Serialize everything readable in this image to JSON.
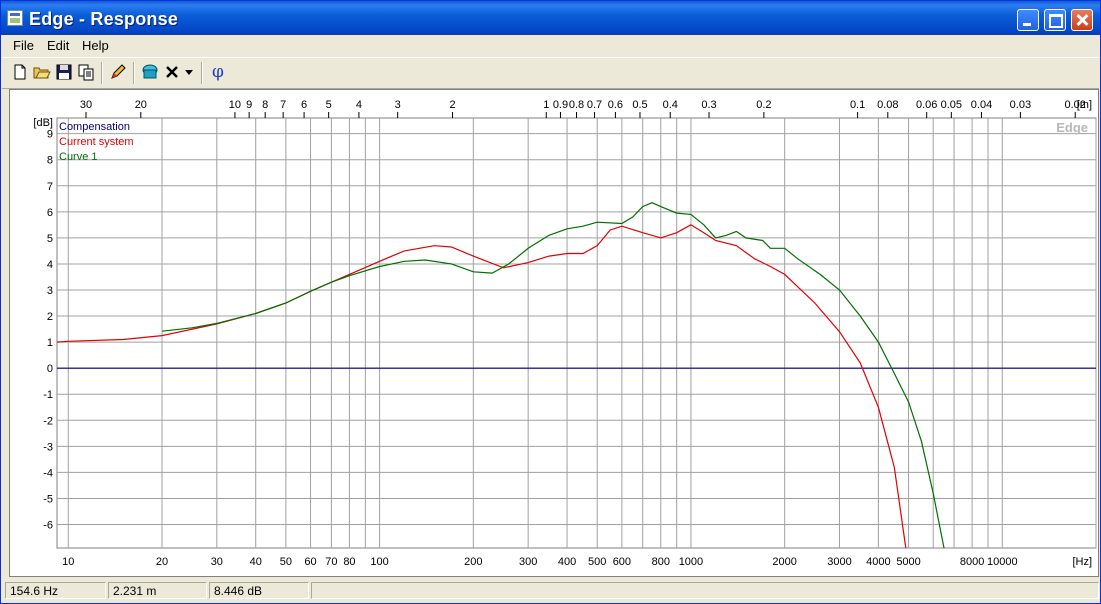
{
  "window": {
    "title": "Edge - Response"
  },
  "menu": [
    "File",
    "Edit",
    "Help"
  ],
  "toolbar": {
    "icons": [
      "new-file-icon",
      "open-folder-icon",
      "save-icon",
      "copy-icon",
      "pencil-icon",
      "speaker-icon",
      "delete-icon",
      "dropdown-arrow-icon",
      "phase-icon"
    ],
    "phase_label": "φ"
  },
  "status": {
    "frequency": "154.6 Hz",
    "distance": "2.231 m",
    "level": "8.446 dB"
  },
  "colors": {
    "compensation": "#000080",
    "current_system": "#e00000",
    "curve1": "#007000",
    "grid": "#a0a0a0",
    "title_bar": "#0a5fd8"
  },
  "chart_data": {
    "type": "line",
    "watermark": "Edge",
    "x_scale": "log",
    "x_range": [
      9.2,
      20000
    ],
    "y_range": [
      -6.9,
      9.6
    ],
    "ylabel": "[dB]",
    "xlabel": "[Hz]",
    "top_axis_label": "[m]",
    "y_ticks": [
      "9",
      "8",
      "7",
      "6",
      "5",
      "4",
      "3",
      "2",
      "1",
      "0",
      "-1",
      "-2",
      "-3",
      "-4",
      "-5",
      "-6"
    ],
    "x_ticks": [
      {
        "v": 10,
        "label": "10"
      },
      {
        "v": 20,
        "label": "20"
      },
      {
        "v": 30,
        "label": "30"
      },
      {
        "v": 40,
        "label": "40"
      },
      {
        "v": 50,
        "label": "50"
      },
      {
        "v": 60,
        "label": "60"
      },
      {
        "v": 70,
        "label": "70"
      },
      {
        "v": 80,
        "label": "80"
      },
      {
        "v": 100,
        "label": "100"
      },
      {
        "v": 200,
        "label": "200"
      },
      {
        "v": 300,
        "label": "300"
      },
      {
        "v": 400,
        "label": "400"
      },
      {
        "v": 500,
        "label": "500"
      },
      {
        "v": 600,
        "label": "600"
      },
      {
        "v": 800,
        "label": "800"
      },
      {
        "v": 1000,
        "label": "1000"
      },
      {
        "v": 2000,
        "label": "2000"
      },
      {
        "v": 3000,
        "label": "3000"
      },
      {
        "v": 4000,
        "label": "4000"
      },
      {
        "v": 5000,
        "label": "5000"
      },
      {
        "v": 8000,
        "label": "8000"
      },
      {
        "v": 10000,
        "label": "10000"
      }
    ],
    "x_grid": [
      10,
      20,
      30,
      40,
      50,
      60,
      70,
      80,
      90,
      100,
      200,
      300,
      400,
      500,
      600,
      700,
      800,
      900,
      1000,
      2000,
      3000,
      4000,
      5000,
      6000,
      7000,
      8000,
      9000,
      10000,
      20000
    ],
    "top_ticks": [
      {
        "v": 11.4,
        "label": "30"
      },
      {
        "v": 17.1,
        "label": "20"
      },
      {
        "v": 34.3,
        "label": "10"
      },
      {
        "v": 38.1,
        "label": "9"
      },
      {
        "v": 42.9,
        "label": "8"
      },
      {
        "v": 49.0,
        "label": "7"
      },
      {
        "v": 57.2,
        "label": "6"
      },
      {
        "v": 68.6,
        "label": "5"
      },
      {
        "v": 85.8,
        "label": "4"
      },
      {
        "v": 114.3,
        "label": "3"
      },
      {
        "v": 171.5,
        "label": "2"
      },
      {
        "v": 343,
        "label": "1"
      },
      {
        "v": 381,
        "label": "0.9"
      },
      {
        "v": 429,
        "label": "0.8"
      },
      {
        "v": 490,
        "label": "0.7"
      },
      {
        "v": 572,
        "label": "0.6"
      },
      {
        "v": 686,
        "label": "0.5"
      },
      {
        "v": 858,
        "label": "0.4"
      },
      {
        "v": 1143,
        "label": "0.3"
      },
      {
        "v": 1715,
        "label": "0.2"
      },
      {
        "v": 3430,
        "label": "0.1"
      },
      {
        "v": 4288,
        "label": "0.08"
      },
      {
        "v": 5717,
        "label": "0.06"
      },
      {
        "v": 6860,
        "label": "0.05"
      },
      {
        "v": 8575,
        "label": "0.04"
      },
      {
        "v": 11433,
        "label": "0.03"
      },
      {
        "v": 17150,
        "label": "0.02"
      }
    ],
    "series": [
      {
        "name": "Compensation",
        "color": "#000080",
        "points": [
          [
            9.2,
            0
          ],
          [
            20000,
            0
          ]
        ]
      },
      {
        "name": "Current system",
        "color": "#e00000",
        "points": [
          [
            9.2,
            1.0
          ],
          [
            10,
            1.03
          ],
          [
            15,
            1.1
          ],
          [
            20,
            1.25
          ],
          [
            30,
            1.7
          ],
          [
            40,
            2.1
          ],
          [
            50,
            2.5
          ],
          [
            60,
            2.95
          ],
          [
            70,
            3.3
          ],
          [
            80,
            3.6
          ],
          [
            100,
            4.1
          ],
          [
            120,
            4.5
          ],
          [
            150,
            4.7
          ],
          [
            170,
            4.65
          ],
          [
            200,
            4.3
          ],
          [
            250,
            3.85
          ],
          [
            300,
            4.05
          ],
          [
            350,
            4.3
          ],
          [
            400,
            4.4
          ],
          [
            450,
            4.4
          ],
          [
            500,
            4.7
          ],
          [
            550,
            5.3
          ],
          [
            600,
            5.45
          ],
          [
            700,
            5.2
          ],
          [
            800,
            5.0
          ],
          [
            900,
            5.2
          ],
          [
            1000,
            5.5
          ],
          [
            1100,
            5.2
          ],
          [
            1200,
            4.9
          ],
          [
            1400,
            4.7
          ],
          [
            1600,
            4.2
          ],
          [
            1800,
            3.9
          ],
          [
            2000,
            3.6
          ],
          [
            2500,
            2.5
          ],
          [
            3000,
            1.4
          ],
          [
            3500,
            0.2
          ],
          [
            4000,
            -1.5
          ],
          [
            4500,
            -3.8
          ],
          [
            4900,
            -6.9
          ]
        ]
      },
      {
        "name": "Curve 1",
        "color": "#007000",
        "points": [
          [
            20,
            1.42
          ],
          [
            25,
            1.55
          ],
          [
            30,
            1.72
          ],
          [
            40,
            2.1
          ],
          [
            50,
            2.5
          ],
          [
            60,
            2.95
          ],
          [
            70,
            3.3
          ],
          [
            80,
            3.55
          ],
          [
            100,
            3.9
          ],
          [
            120,
            4.1
          ],
          [
            140,
            4.15
          ],
          [
            170,
            4.0
          ],
          [
            200,
            3.7
          ],
          [
            230,
            3.65
          ],
          [
            260,
            4.0
          ],
          [
            300,
            4.6
          ],
          [
            350,
            5.1
          ],
          [
            400,
            5.35
          ],
          [
            450,
            5.45
          ],
          [
            500,
            5.6
          ],
          [
            600,
            5.55
          ],
          [
            650,
            5.8
          ],
          [
            700,
            6.2
          ],
          [
            750,
            6.35
          ],
          [
            800,
            6.2
          ],
          [
            900,
            5.95
          ],
          [
            1000,
            5.9
          ],
          [
            1100,
            5.5
          ],
          [
            1200,
            5.0
          ],
          [
            1300,
            5.1
          ],
          [
            1400,
            5.25
          ],
          [
            1500,
            5.0
          ],
          [
            1700,
            4.9
          ],
          [
            1800,
            4.6
          ],
          [
            2000,
            4.6
          ],
          [
            2200,
            4.2
          ],
          [
            2600,
            3.6
          ],
          [
            3000,
            3.0
          ],
          [
            3500,
            2.0
          ],
          [
            4000,
            1.0
          ],
          [
            4500,
            -0.2
          ],
          [
            5000,
            -1.3
          ],
          [
            5500,
            -2.8
          ],
          [
            6000,
            -4.8
          ],
          [
            6500,
            -6.9
          ]
        ]
      }
    ]
  }
}
